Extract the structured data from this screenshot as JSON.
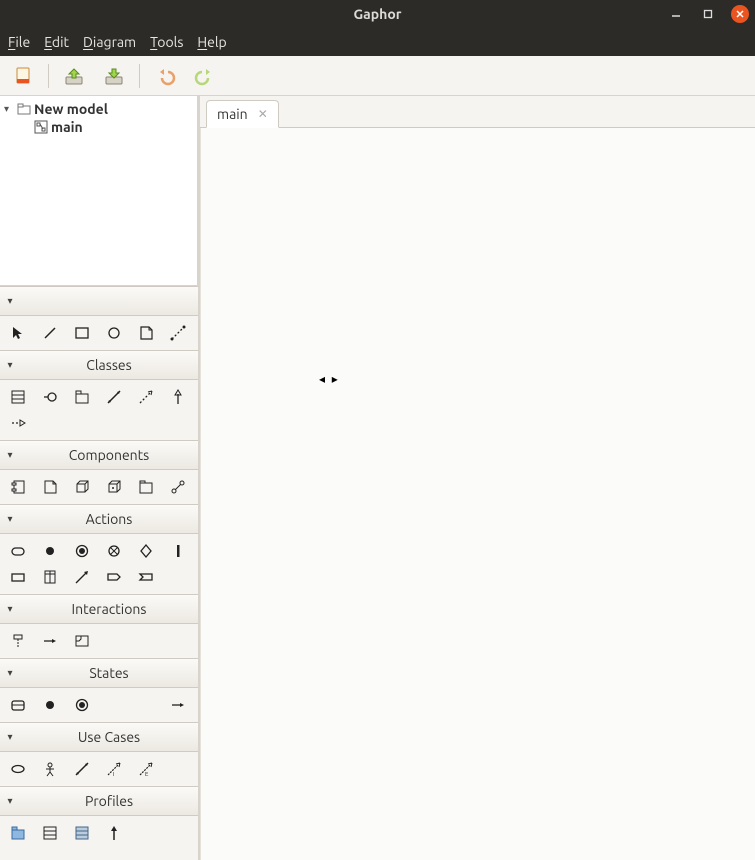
{
  "window": {
    "title": "Gaphor"
  },
  "menu": {
    "file": "File",
    "edit": "Edit",
    "diagram": "Diagram",
    "tools": "Tools",
    "help": "Help"
  },
  "tree": {
    "root": "New model",
    "diagram": "main"
  },
  "tab": {
    "label": "main"
  },
  "palette": {
    "general": "",
    "classes": "Classes",
    "components": "Components",
    "actions": "Actions",
    "interactions": "Interactions",
    "states": "States",
    "usecases": "Use Cases",
    "profiles": "Profiles"
  }
}
